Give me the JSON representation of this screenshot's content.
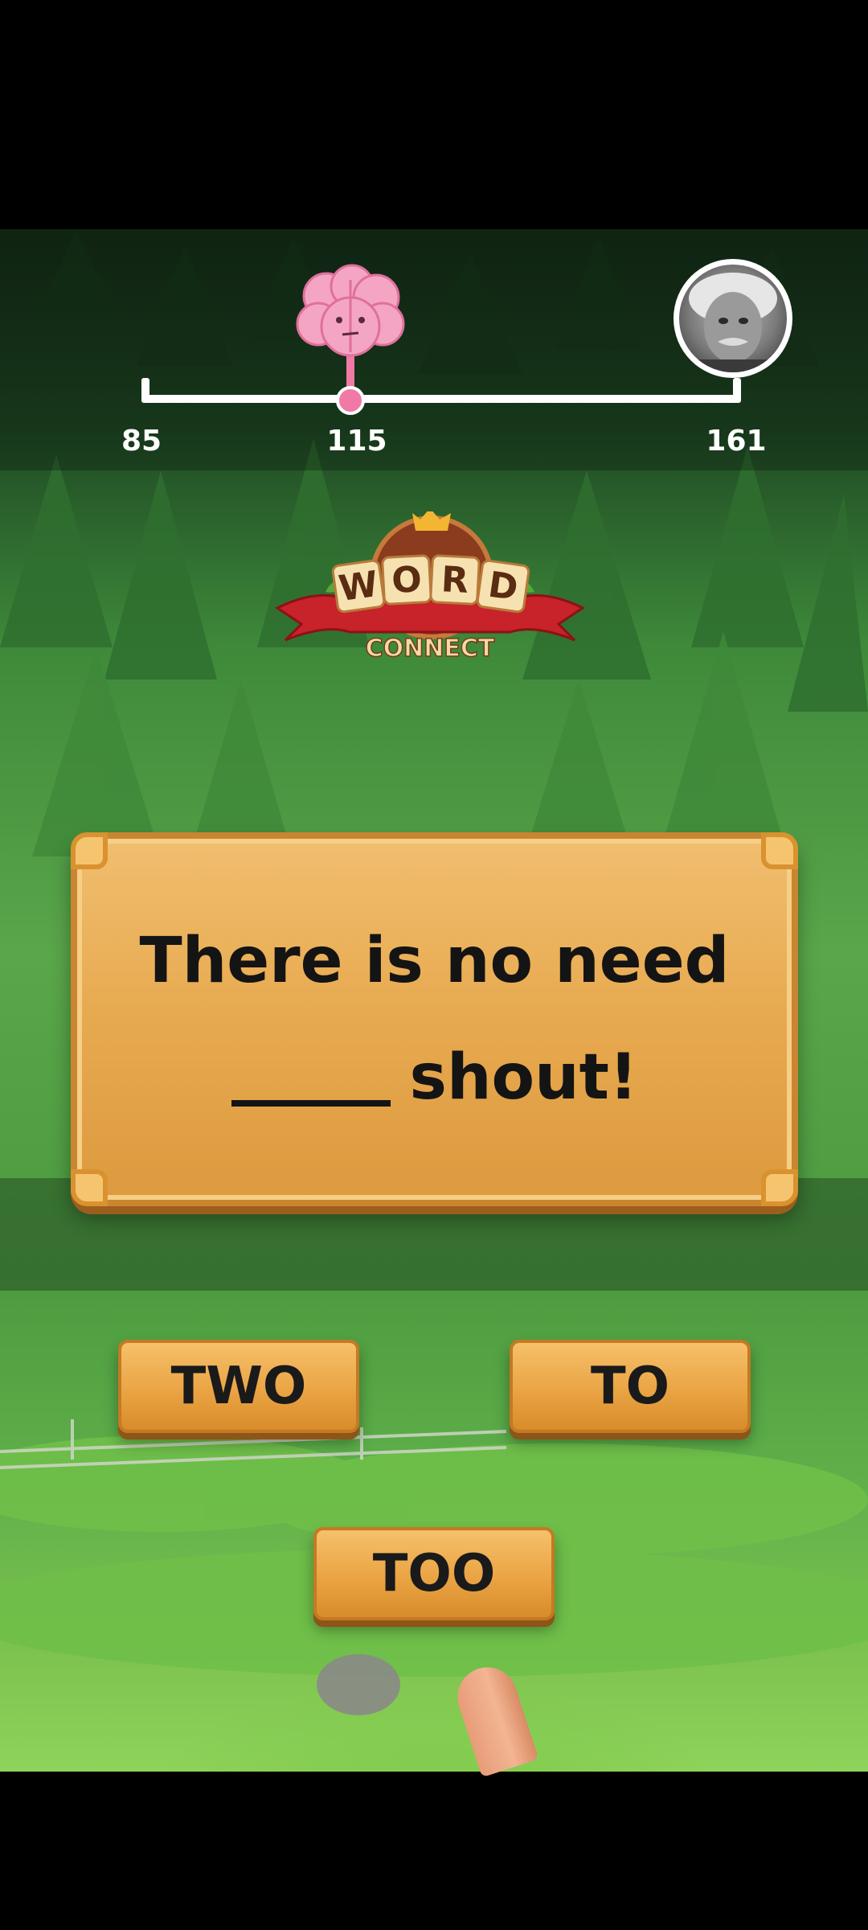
{
  "progress": {
    "start_score": "85",
    "current_score": "115",
    "target_score": "161",
    "current_fraction": 0.39
  },
  "logo": {
    "word_letters": [
      "W",
      "O",
      "R",
      "D"
    ],
    "subtitle": "CONNECT"
  },
  "question": {
    "line1": "There is no need",
    "line2_after_blank": "shout!"
  },
  "answers": [
    {
      "label": "TWO"
    },
    {
      "label": "TO"
    },
    {
      "label": "TOO"
    }
  ],
  "colors": {
    "board_wood": "#e7a94f",
    "answer_wood": "#eaa444",
    "brain_pink": "#f07aa5",
    "logo_red": "#c8222a"
  },
  "icons": {
    "level_marker": "brain-icon",
    "goal_marker": "genius-avatar",
    "logo_crown": "crown-icon",
    "hint": "finger-pointer-icon"
  }
}
